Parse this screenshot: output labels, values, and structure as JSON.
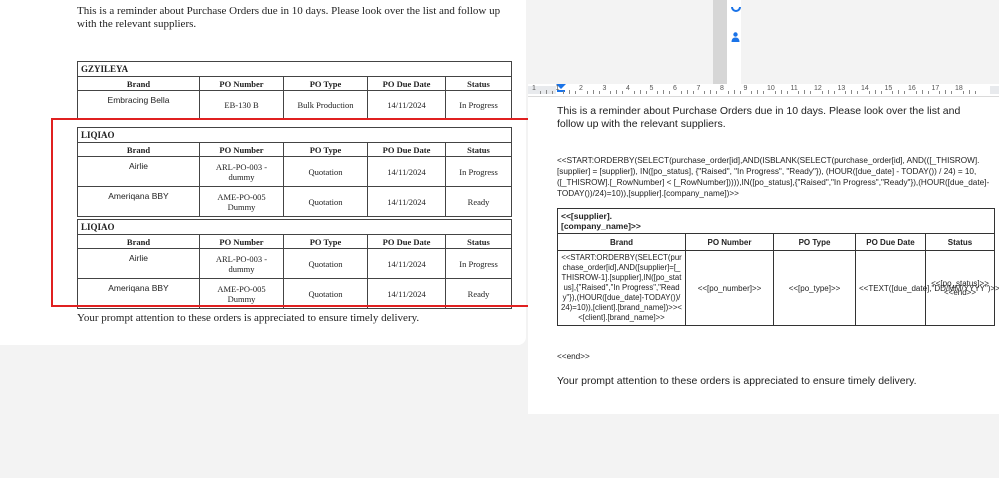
{
  "left_doc": {
    "intro": "This is a reminder about Purchase Orders due in 10 days. Please look over the list and follow up with the relevant suppliers.",
    "closing": "Your prompt attention to these orders is appreciated to ensure timely delivery.",
    "headers": [
      "Brand",
      "PO Number",
      "PO Type",
      "PO Due Date",
      "Status"
    ],
    "groups": [
      {
        "supplier": "GZYILEYA",
        "rows": [
          {
            "brand": "Embracing Bella",
            "po_number": "EB-130 B",
            "po_type": "Bulk Production",
            "due": "14/11/2024",
            "status": "In Progress"
          }
        ]
      },
      {
        "supplier": "LIQIAO",
        "rows": [
          {
            "brand": "Airlie",
            "po_number": "ARL-PO-003 - dummy",
            "po_type": "Quotation",
            "due": "14/11/2024",
            "status": "In Progress"
          },
          {
            "brand": "Ameriqana BBY",
            "po_number": "AME-PO-005 Dummy",
            "po_type": "Quotation",
            "due": "14/11/2024",
            "status": "Ready"
          }
        ]
      },
      {
        "supplier": "LIQIAO",
        "rows": [
          {
            "brand": "Airlie",
            "po_number": "ARL-PO-003 - dummy",
            "po_type": "Quotation",
            "due": "14/11/2024",
            "status": "In Progress"
          },
          {
            "brand": "Ameriqana BBY",
            "po_number": "AME-PO-005 Dummy",
            "po_type": "Quotation",
            "due": "14/11/2024",
            "status": "Ready"
          }
        ]
      }
    ]
  },
  "template_doc": {
    "ruler_numbers": [
      "1",
      "1",
      "2",
      "3",
      "4",
      "5",
      "6",
      "7",
      "8",
      "9",
      "10",
      "11",
      "12",
      "13",
      "14",
      "15",
      "16",
      "17",
      "18"
    ],
    "intro": "This is a reminder about Purchase Orders due in 10 days. Please look over the list and follow up with the relevant suppliers.",
    "formula": "<<START:ORDERBY(SELECT(purchase_order[id],AND(ISBLANK(SELECT(purchase_order[id], AND(([_THISROW].[supplier] = [supplier]), IN([po_status], {\"Raised\", \"In Progress\", \"Ready\"}), (HOUR([due_date] - TODAY()) / 24) = 10, ([_THISROW].[_RowNumber] < [_RowNumber])))),IN([po_status],{\"Raised\",\"In Progress\",\"Ready\"}),(HOUR([due_date]-TODAY())/24)=10)),[supplier].[company_name])>>",
    "supplier_placeholder": "<<[supplier].[company_name]>>",
    "headers": [
      "Brand",
      "PO Number",
      "PO Type",
      "PO Due Date",
      "Status"
    ],
    "brand_cell": "<<START:ORDERBY(SELECT(purchase_order[id],AND([supplier]=[_THISROW-1].[supplier],IN([po_status],{\"Raised\",\"In Progress\",\"Ready\"}),(HOUR([due_date]-TODAY())/24)=10)),[client].[brand_name])>><<[client].[brand_name]>>",
    "po_number_cell": "<<[po_number]>>",
    "po_type_cell": "<<[po_type]>>",
    "due_cell": "<<TEXT([due_date],\"DD/MM/YYYY\")>>",
    "status_cell": "<<[po_status]>> <<end>>",
    "end_tag": "<<end>>",
    "closing": "Your prompt attention to these orders is appreciated to ensure timely delivery."
  },
  "colors": {
    "highlight": "#e02020",
    "accent_blue": "#1a73e8"
  }
}
